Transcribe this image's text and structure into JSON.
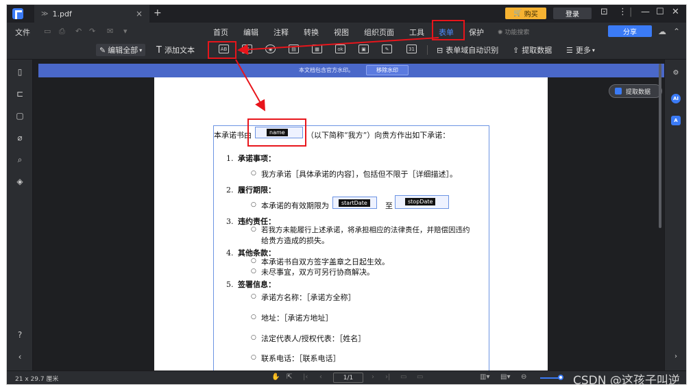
{
  "titlebar": {
    "tab_title": "1.pdf",
    "tab_close": "×",
    "new_tab": "+",
    "buy": "购买",
    "login": "登录",
    "controls": [
      "⊡",
      "⋮",
      "|",
      "—",
      "☐",
      "✕"
    ]
  },
  "menubar": {
    "file": "文件",
    "items": [
      "首页",
      "编辑",
      "注释",
      "转换",
      "视图",
      "组织页面",
      "工具",
      "表单",
      "保护"
    ],
    "active_item": "表单",
    "search_placeholder": "功能搜索",
    "share": "分享"
  },
  "toolbar": {
    "edit_all": "编辑全部",
    "add_text": "添加文本",
    "field_icons": [
      "AB",
      "☑",
      "◉",
      "▤",
      "▦",
      "ok",
      "▣",
      "✎",
      "31"
    ],
    "auto_detect": "表单域自动识别",
    "extract_data": "提取数据",
    "more": "更多"
  },
  "watermark": {
    "notice": "本文档包含官方水印。",
    "remove": "移除水印"
  },
  "extract_float": "提取数据",
  "document": {
    "intro_prefix": "本承诺书由",
    "intro_suffix": "（以下简称“我方”）向贵方作出如下承诺：",
    "s1_num": "1.",
    "s1_title": "承诺事项",
    "s1_colon": "：",
    "s1_b1": "我方承诺［具体承诺的内容］，包括但不限于［详细描述］。",
    "s2_num": "2.",
    "s2_title": "履行期限",
    "s2_colon": "：",
    "s2_b1_prefix": "本承诺的有效期限为",
    "s2_b1_mid": "至",
    "s3_num": "3.",
    "s3_title": "违约责任",
    "s3_colon": "：",
    "s3_b1_l1": "若我方未能履行上述承诺，将承担相应的法律责任，并赔偿因违约",
    "s3_b1_l2": "给贵方造成的损失。",
    "s4_num": "4.",
    "s4_title": "其他条款",
    "s4_colon": "：",
    "s4_b1": "本承诺书自双方签字盖章之日起生效。",
    "s4_b2": "未尽事宜，双方可另行协商解决。",
    "s5_num": "5.",
    "s5_title": "签署信息",
    "s5_colon": "：",
    "s5_b1": "承诺方名称：［承诺方全称］",
    "s5_b2": "地址：［承诺方地址］",
    "s5_b3": "法定代表人/授权代表：［姓名］",
    "s5_b4": "联系电话：［联系电话］"
  },
  "fields": {
    "name": "name",
    "start": "startDate",
    "stop": "stopDate"
  },
  "statusbar": {
    "page_size": "21 x 29.7 厘米",
    "page_indicator": "1/1",
    "credit": "CSDN @这孩子叫逆"
  },
  "colors": {
    "accent": "#3b7bf6",
    "annotation": "#e8151b",
    "buy": "#f6b332",
    "watermark_bar": "#4a68c9"
  }
}
